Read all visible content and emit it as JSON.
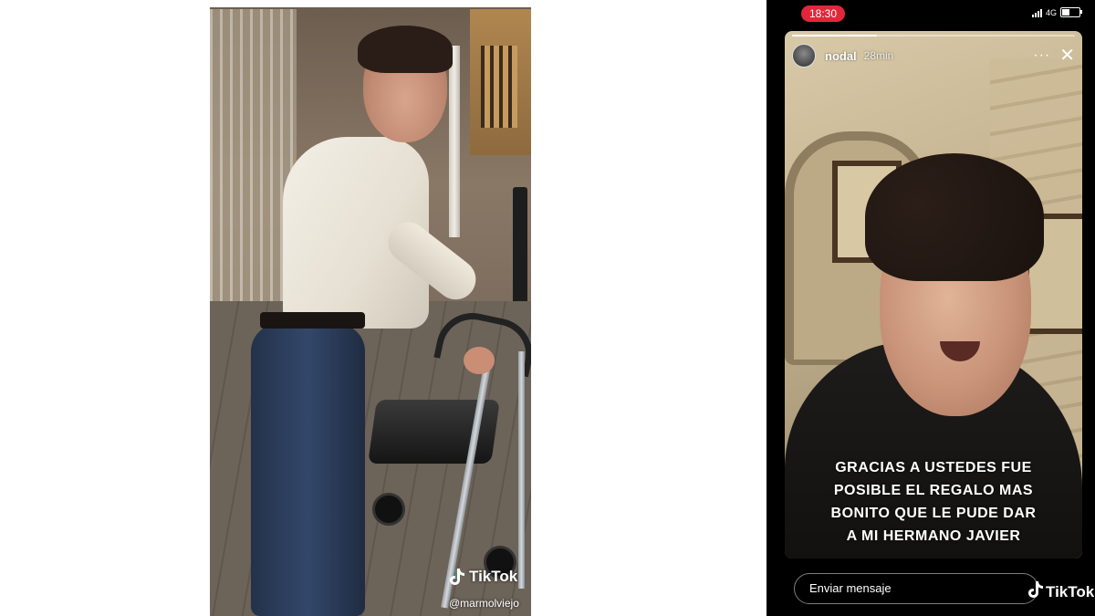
{
  "left_video": {
    "tiktok_label": "TikTok",
    "tiktok_username": "@marmolviejo"
  },
  "story": {
    "status_time": "18:30",
    "network": "4G",
    "username": "nodal",
    "posted_ago": "28min",
    "more_label": "···",
    "close_label": "✕",
    "caption_lines": [
      "GRACIAS A USTEDES FUE",
      "POSIBLE EL REGALO MAS",
      "BONITO QUE LE PUDE DAR",
      "A MI HERMANO JAVIER"
    ],
    "reply_placeholder": "Enviar mensaje",
    "tiktok_label": "TikTok"
  },
  "colors": {
    "time_pill": "#e0283a",
    "story_bg": "#000000",
    "text": "#ffffff"
  },
  "icons": [
    "tiktok-logo-icon",
    "signal-icon",
    "battery-icon",
    "more-icon",
    "close-icon",
    "avatar-icon"
  ]
}
